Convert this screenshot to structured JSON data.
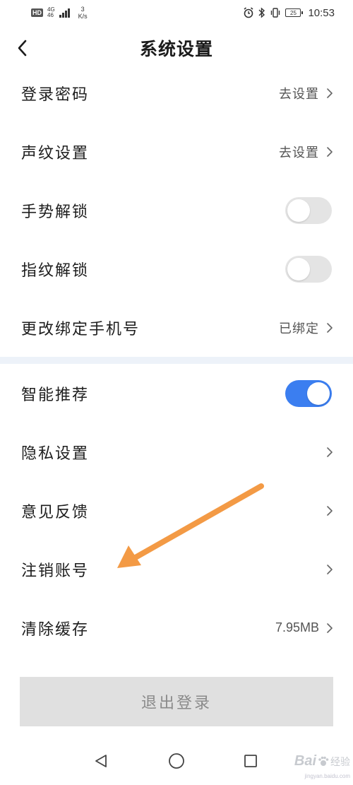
{
  "status_bar": {
    "hd": "HD",
    "net_top": "4G",
    "net_bottom": "46",
    "speed_value": "3",
    "speed_unit": "K/s",
    "battery": "25",
    "time": "10:53"
  },
  "header": {
    "title": "系统设置"
  },
  "settings": {
    "login_password": {
      "label": "登录密码",
      "value": "去设置"
    },
    "voiceprint": {
      "label": "声纹设置",
      "value": "去设置"
    },
    "gesture_unlock": {
      "label": "手势解锁",
      "enabled": false
    },
    "fingerprint_unlock": {
      "label": "指纹解锁",
      "enabled": false
    },
    "change_phone": {
      "label": "更改绑定手机号",
      "value": "已绑定"
    },
    "smart_recommend": {
      "label": "智能推荐",
      "enabled": true
    },
    "privacy": {
      "label": "隐私设置"
    },
    "feedback": {
      "label": "意见反馈"
    },
    "cancel_account": {
      "label": "注销账号"
    },
    "clear_cache": {
      "label": "清除缓存",
      "value": "7.95MB"
    }
  },
  "logout_label": "退出登录",
  "watermark": {
    "brand": "Bai",
    "brand_suffix": "经验",
    "url": "jingyan.baidu.com"
  },
  "colors": {
    "toggle_on": "#3b7ef0",
    "toggle_off": "#e4e4e4",
    "arrow": "#f39a45",
    "section_gap": "#edf2f9",
    "logout_bg": "#e0e0e0"
  }
}
